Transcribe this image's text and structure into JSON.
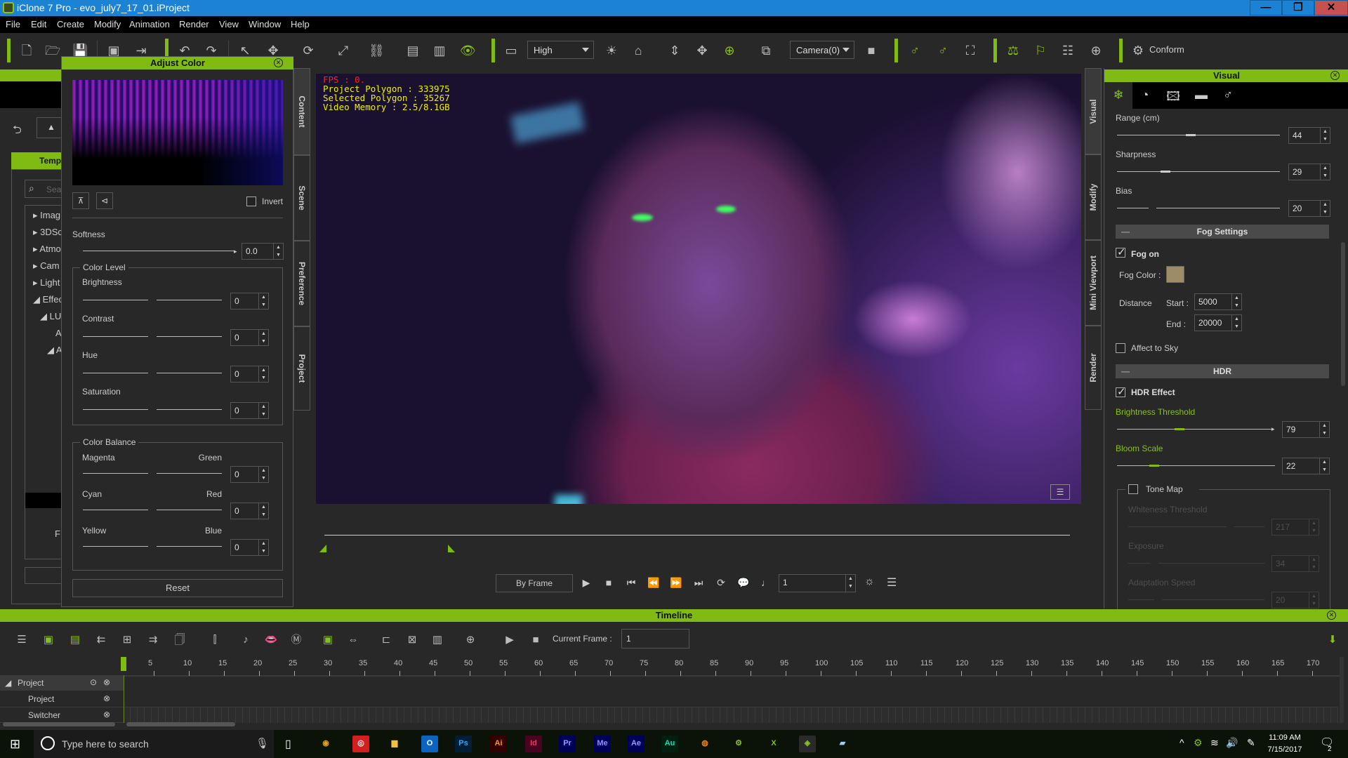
{
  "window": {
    "title": "iClone 7 Pro - evo_july7_17_01.iProject",
    "min": "—",
    "max": "❐",
    "close": "✕"
  },
  "menu": [
    "File",
    "Edit",
    "Create",
    "Modify",
    "Animation",
    "Render",
    "View",
    "Window",
    "Help"
  ],
  "toolbar": {
    "quality": "High",
    "camera": "Camera(0)",
    "conform_label": "Conform"
  },
  "left_panel": {
    "tab_label": "Temp",
    "search_placeholder": "Sea",
    "tree": [
      "Imag",
      "3DSc",
      "Atmo",
      "Cam",
      "Light",
      "Effec",
      "LUT",
      "A",
      "A"
    ],
    "footer_letter": "F"
  },
  "adjust_color": {
    "title": "Adjust Color",
    "invert_label": "Invert",
    "invert_checked": false,
    "softness_label": "Softness",
    "softness_value": "0.0",
    "color_level_title": "Color Level",
    "levels": [
      {
        "label": "Brightness",
        "value": "0"
      },
      {
        "label": "Contrast",
        "value": "0"
      },
      {
        "label": "Hue",
        "value": "0"
      },
      {
        "label": "Saturation",
        "value": "0"
      }
    ],
    "color_balance_title": "Color Balance",
    "balance": [
      {
        "left": "Magenta",
        "right": "Green",
        "value": "0"
      },
      {
        "left": "Cyan",
        "right": "Red",
        "value": "0"
      },
      {
        "left": "Yellow",
        "right": "Blue",
        "value": "0"
      }
    ],
    "reset_label": "Reset"
  },
  "left_vtabs": [
    "Content",
    "Scene",
    "Preference",
    "Project"
  ],
  "right_vtabs": [
    "Visual",
    "Modify",
    "Mini Viewport",
    "Render"
  ],
  "viewport": {
    "fps": "FPS : 0.",
    "project_polygon": "Project Polygon : 333975",
    "selected_polygon": "Selected Polygon : 35267",
    "video_memory": "Video Memory : 2.5/8.1GB"
  },
  "playback": {
    "mode": "By Frame",
    "frame": "1"
  },
  "visual_panel": {
    "title": "Visual",
    "range_label": "Range (cm)",
    "range_value": "44",
    "sharpness_label": "Sharpness",
    "sharpness_value": "29",
    "bias_label": "Bias",
    "bias_value": "20",
    "fog_section": "Fog Settings",
    "fog_on_label": "Fog on",
    "fog_on": true,
    "fog_color_label": "Fog Color :",
    "fog_color": "#9c8c68",
    "distance_label": "Distance",
    "start_label": "Start :",
    "start_value": "5000",
    "end_label": "End :",
    "end_value": "20000",
    "affect_sky_label": "Affect to Sky",
    "affect_sky": false,
    "hdr_section": "HDR",
    "hdr_effect_label": "HDR Effect",
    "hdr_effect": true,
    "brightness_threshold_label": "Brightness Threshold",
    "brightness_threshold_value": "79",
    "bloom_scale_label": "Bloom Scale",
    "bloom_scale_value": "22",
    "tone_map_label": "Tone Map",
    "tone_map": false,
    "whiteness_label": "Whiteness Threshold",
    "whiteness_value": "217",
    "exposure_label": "Exposure",
    "exposure_value": "34",
    "adaptation_label": "Adaptation Speed",
    "adaptation_value": "20"
  },
  "timeline": {
    "title": "Timeline",
    "current_frame_label": "Current Frame :",
    "current_frame_value": "1",
    "ticks": [
      "5",
      "10",
      "15",
      "20",
      "25",
      "30",
      "35",
      "40",
      "45",
      "50",
      "55",
      "60",
      "65",
      "70",
      "75",
      "80",
      "85",
      "90",
      "95",
      "100",
      "105",
      "110",
      "115",
      "120",
      "125",
      "130",
      "135",
      "140",
      "145",
      "150",
      "155",
      "160",
      "165",
      "170"
    ],
    "tracks": [
      "Project",
      "Project",
      "Switcher"
    ]
  },
  "taskbar": {
    "search_placeholder": "Type here to search",
    "time": "11:09 AM",
    "date": "7/15/2017",
    "notification_count": "2",
    "apps": [
      {
        "name": "chrome",
        "glyph": "◉",
        "color": "#e0a020",
        "bg": "transparent"
      },
      {
        "name": "creative-cloud",
        "glyph": "◎",
        "color": "#fff",
        "bg": "#d41f1f"
      },
      {
        "name": "file-explorer",
        "glyph": "▆",
        "color": "#f0c040",
        "bg": "transparent"
      },
      {
        "name": "outlook",
        "glyph": "O",
        "color": "#fff",
        "bg": "#0a64c0"
      },
      {
        "name": "photoshop",
        "glyph": "Ps",
        "color": "#31a8ff",
        "bg": "#001e36"
      },
      {
        "name": "illustrator",
        "glyph": "Ai",
        "color": "#ff9a00",
        "bg": "#330000"
      },
      {
        "name": "indesign",
        "glyph": "Id",
        "color": "#ff3366",
        "bg": "#49021f"
      },
      {
        "name": "premiere",
        "glyph": "Pr",
        "color": "#9999ff",
        "bg": "#00005b"
      },
      {
        "name": "media-encoder",
        "glyph": "Me",
        "color": "#8f8fff",
        "bg": "#00005b"
      },
      {
        "name": "after-effects",
        "glyph": "Ae",
        "color": "#9999ff",
        "bg": "#00005b"
      },
      {
        "name": "audition",
        "glyph": "Au",
        "color": "#00e4bb",
        "bg": "#00200f"
      },
      {
        "name": "blender",
        "glyph": "◍",
        "color": "#f08020",
        "bg": "transparent"
      },
      {
        "name": "character-creator",
        "glyph": "⚙",
        "color": "#86c01a",
        "bg": "transparent"
      },
      {
        "name": "3dxchange",
        "glyph": "X",
        "color": "#86c01a",
        "bg": "transparent"
      },
      {
        "name": "iclone",
        "glyph": "◈",
        "color": "#86c01a",
        "bg": "#2a2a2a"
      },
      {
        "name": "app-cube",
        "glyph": "▰",
        "color": "#a0d0f0",
        "bg": "transparent"
      }
    ]
  },
  "colors": {
    "accent": "#80bb14",
    "title_bar": "#1c82d4",
    "close_button": "#c75050"
  }
}
